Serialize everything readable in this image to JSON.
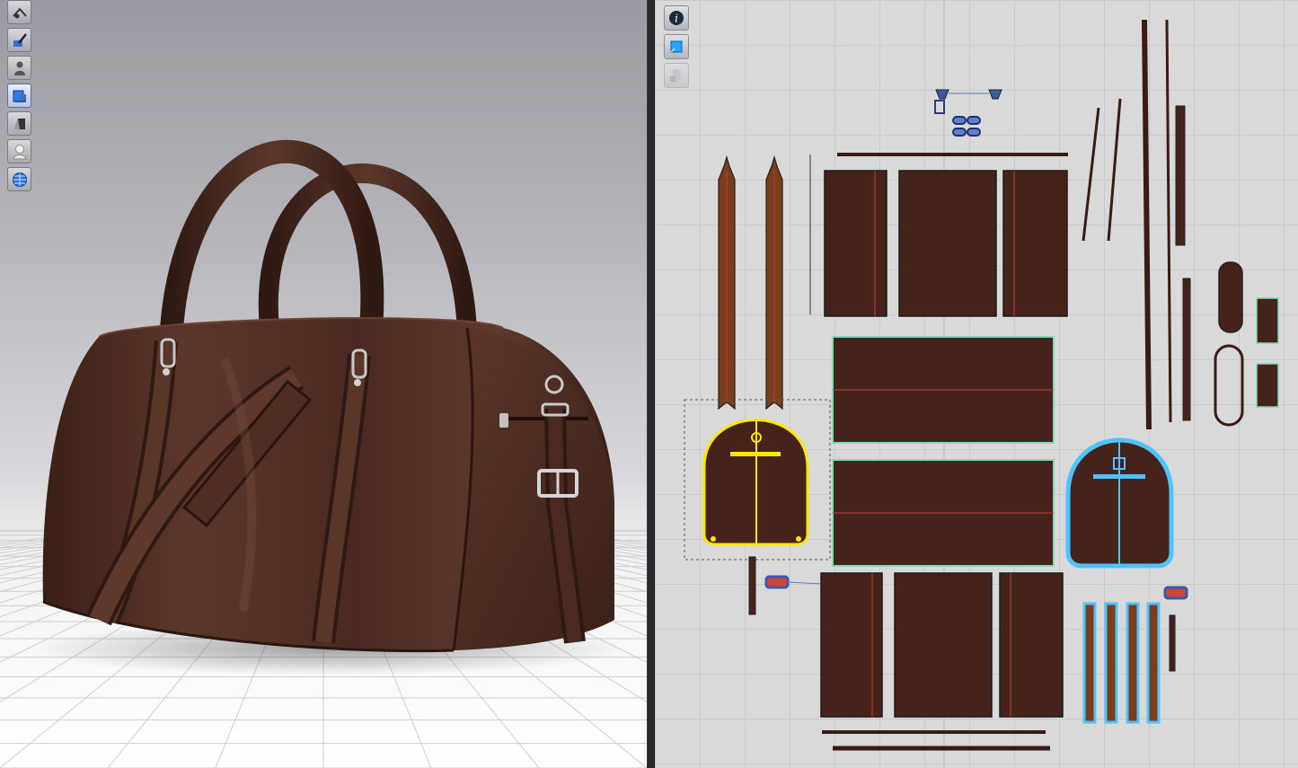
{
  "window": {
    "left_panel": "3d-garment-view",
    "right_panel": "2d-pattern-view"
  },
  "toolbar_3d": {
    "buttons": [
      {
        "icon": "show-avatar-icon",
        "active": false
      },
      {
        "icon": "texture-paint-icon",
        "active": false
      },
      {
        "icon": "avatar-silhouette-icon",
        "active": false
      },
      {
        "icon": "garment-view-icon",
        "active": true
      },
      {
        "icon": "shaded-view-icon",
        "active": false
      },
      {
        "icon": "avatar-head-icon",
        "active": false
      },
      {
        "icon": "globe-environment-icon",
        "active": false
      }
    ]
  },
  "toolbar_2d": {
    "buttons": [
      {
        "icon": "info-icon",
        "enabled": true
      },
      {
        "icon": "pattern-layer-icon",
        "enabled": true
      },
      {
        "icon": "locked-garment-icon",
        "enabled": false
      }
    ]
  },
  "colors": {
    "leather": "#4a2a1f",
    "leather_dark": "#2c1812",
    "pattern_fill": "#46231a",
    "strap_fill": "#7a3d1c",
    "selection_yellow": "#ffe600",
    "selection_blue": "#4fc3ff",
    "seam_red": "#d23a3a",
    "edge_green": "#7fd9b9",
    "grid_bg": "#d9d9d9"
  }
}
